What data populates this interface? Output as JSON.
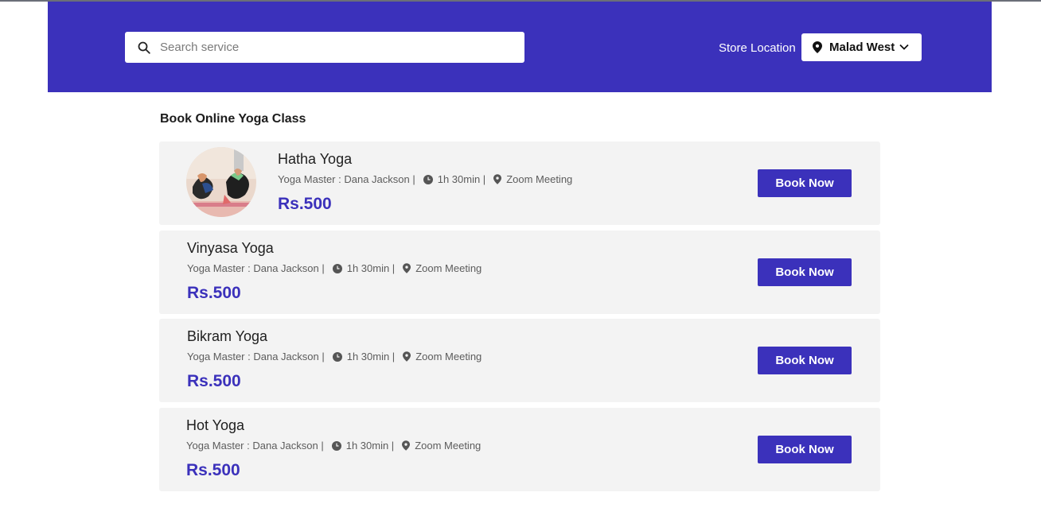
{
  "header": {
    "search_placeholder": "Search service",
    "store_location_label": "Store Location",
    "store_location_value": "Malad West"
  },
  "section_title": "Book Online Yoga Class",
  "classes": [
    {
      "name": "Hatha Yoga",
      "master": "Yoga Master : Dana Jackson |",
      "duration": "1h 30min |",
      "venue": "Zoom Meeting",
      "price": "Rs.500",
      "cta": "Book Now"
    },
    {
      "name": "Vinyasa Yoga",
      "master": "Yoga Master : Dana Jackson |",
      "duration": "1h 30min |",
      "venue": "Zoom Meeting",
      "price": "Rs.500",
      "cta": "Book Now"
    },
    {
      "name": "Bikram Yoga",
      "master": "Yoga Master : Dana Jackson |",
      "duration": "1h 30min |",
      "venue": "Zoom Meeting",
      "price": "Rs.500",
      "cta": "Book Now"
    },
    {
      "name": "Hot Yoga",
      "master": "Yoga Master : Dana Jackson |",
      "duration": "1h 30min |",
      "venue": "Zoom Meeting",
      "price": "Rs.500",
      "cta": "Book Now"
    }
  ],
  "colors": {
    "brand": "#3b31bb",
    "card_bg": "#f3f3f3"
  },
  "icons": [
    "search-icon",
    "location-pin-icon",
    "chevron-down-icon",
    "clock-icon"
  ]
}
